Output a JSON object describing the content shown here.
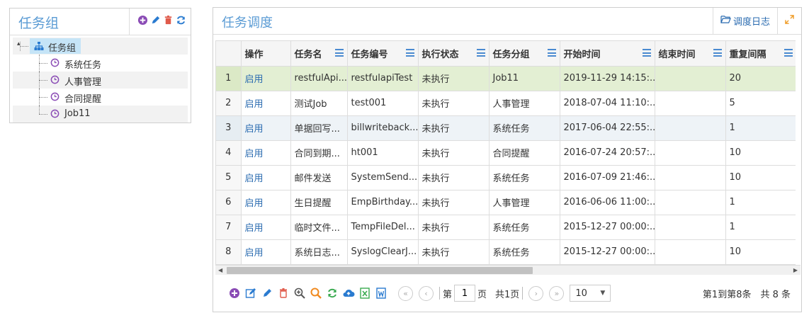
{
  "left_panel": {
    "title": "任务组",
    "tree": {
      "root": "任务组",
      "children": [
        "系统任务",
        "人事管理",
        "合同提醒",
        "Job11"
      ]
    }
  },
  "right_panel": {
    "title": "任务调度",
    "log_button": "调度日志"
  },
  "table": {
    "columns": [
      "操作",
      "任务名",
      "任务编号",
      "执行状态",
      "任务分组",
      "开始时间",
      "结束时间",
      "重复间隔"
    ],
    "rows": [
      {
        "n": "1",
        "op": "启用",
        "name": "restfulApi...",
        "code": "restfulapiTest",
        "status": "未执行",
        "group": "Job11",
        "start": "2019-11-29 14:15:...",
        "end": "",
        "interval": "20"
      },
      {
        "n": "2",
        "op": "启用",
        "name": "测试Job",
        "code": "test001",
        "status": "未执行",
        "group": "人事管理",
        "start": "2018-07-04 11:10:...",
        "end": "",
        "interval": "5"
      },
      {
        "n": "3",
        "op": "启用",
        "name": "单据回写...",
        "code": "billwriteback...",
        "status": "未执行",
        "group": "系统任务",
        "start": "2017-06-04 22:55:...",
        "end": "",
        "interval": "1"
      },
      {
        "n": "4",
        "op": "启用",
        "name": "合同到期...",
        "code": "ht001",
        "status": "未执行",
        "group": "合同提醒",
        "start": "2016-07-24 20:57:...",
        "end": "",
        "interval": "10"
      },
      {
        "n": "5",
        "op": "启用",
        "name": "邮件发送",
        "code": "SystemSend...",
        "status": "未执行",
        "group": "系统任务",
        "start": "2016-07-09 21:46:...",
        "end": "",
        "interval": "10"
      },
      {
        "n": "6",
        "op": "启用",
        "name": "生日提醒",
        "code": "EmpBirthday...",
        "status": "未执行",
        "group": "人事管理",
        "start": "2016-06-06 11:00:...",
        "end": "",
        "interval": "1"
      },
      {
        "n": "7",
        "op": "启用",
        "name": "临时文件...",
        "code": "TempFileDel...",
        "status": "未执行",
        "group": "系统任务",
        "start": "2015-12-27 00:00:...",
        "end": "",
        "interval": "1"
      },
      {
        "n": "8",
        "op": "启用",
        "name": "系统日志...",
        "code": "SyslogClearJ...",
        "status": "未执行",
        "group": "系统任务",
        "start": "2015-12-27 00:00:...",
        "end": "",
        "interval": "10"
      }
    ]
  },
  "pager": {
    "page_prefix": "第",
    "page_value": "1",
    "page_suffix": "页",
    "total_pages": "共1页",
    "page_size": "10",
    "summary": "第1到第8条　共 8 条"
  },
  "colors": {
    "accent": "#5a9bd4",
    "link": "#2a6bb0",
    "selected_row": "#e3efd3"
  }
}
